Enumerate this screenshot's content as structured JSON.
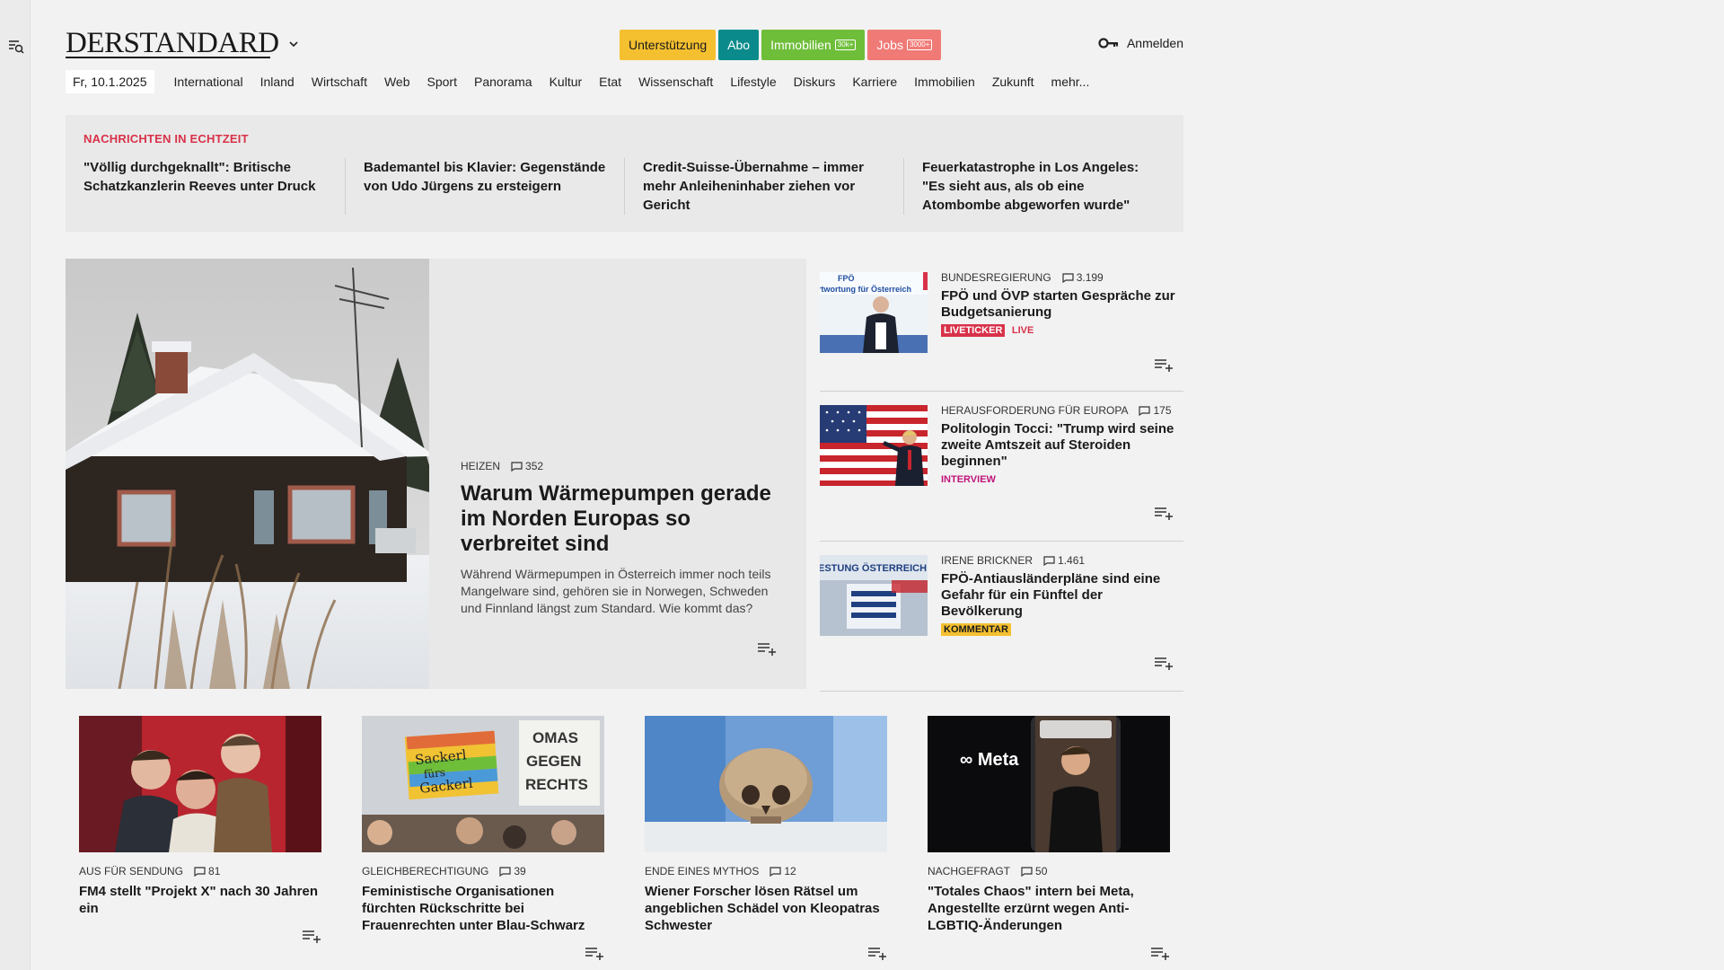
{
  "header": {
    "logo": "DERSTANDARD",
    "pills": [
      {
        "label": "Unterstützung",
        "badge": "",
        "bg": "#f5c030",
        "fg": "#1a1a1a"
      },
      {
        "label": "Abo",
        "badge": "",
        "bg": "#0a8a8a",
        "fg": "#ffffff"
      },
      {
        "label": "Immobilien",
        "badge": "30k+",
        "bg": "#6fbe3a",
        "fg": "#ffffff"
      },
      {
        "label": "Jobs",
        "badge": "3000+",
        "bg": "#f07a76",
        "fg": "#ffffff"
      }
    ],
    "login": "Anmelden"
  },
  "nav": {
    "date": "Fr, 10.1.2025",
    "items": [
      "International",
      "Inland",
      "Wirtschaft",
      "Web",
      "Sport",
      "Panorama",
      "Kultur",
      "Etat",
      "Wissenschaft",
      "Lifestyle",
      "Diskurs",
      "Karriere",
      "Immobilien",
      "Zukunft",
      "mehr..."
    ]
  },
  "ticker": {
    "label": "NACHRICHTEN IN ECHTZEIT",
    "items": [
      "\"Völlig durchgeknallt\": Britische Schatzkanzlerin Reeves unter Druck",
      "Bademantel bis Klavier: Gegenstände von Udo Jürgens zu ersteigern",
      "Credit-Suisse-Übernahme – immer mehr Anleiheninhaber ziehen vor Gericht",
      "Feuerkatastrophe in Los Angeles: \"Es sieht aus, als ob eine Atombombe abgeworfen wurde\""
    ]
  },
  "hero": {
    "kicker": "HEIZEN",
    "comments": "352",
    "title": "Warum Wärmepumpen gerade im Norden Europas so verbreitet sind",
    "lead": "Während Wärmepumpen in Österreich immer noch teils Mangelware sind, gehören sie in Norwegen, Schweden und Finnland längst zum Standard. Wie kommt das?"
  },
  "side": [
    {
      "kicker": "BUNDESREGIERUNG",
      "comments": "3.199",
      "title": "FPÖ und ÖVP starten Gespräche zur Budgetsanierung",
      "tag": "LIVETICKER",
      "tag2": "LIVE"
    },
    {
      "kicker": "HERAUSFORDERUNG FÜR EUROPA",
      "comments": "175",
      "title": "Politologin Tocci: \"Trump wird seine zweite Amtszeit auf Steroiden beginnen\"",
      "tag": "INTERVIEW",
      "tag2": ""
    },
    {
      "kicker": "IRENE BRICKNER",
      "comments": "1.461",
      "title": "FPÖ-Antiausländerpläne sind eine Gefahr für ein Fünftel der Bevölkerung",
      "tag": "KOMMENTAR",
      "tag2": ""
    }
  ],
  "images": {
    "fpo_banner": "FPÖ",
    "fpo_slogan": "rtwortung für Österreich",
    "poster_title": "ESTUNG ÖSTERREICH",
    "omas_sign": [
      "OMAS",
      "GEGEN",
      "RECHTS"
    ],
    "sackerl_sign": [
      "Sackerl",
      "fürs",
      "Gackerl"
    ],
    "meta_logo": "∞ Meta"
  },
  "cards": [
    {
      "kicker": "AUS FÜR SENDUNG",
      "comments": "81",
      "title": "FM4 stellt \"Projekt X\" nach 30 Jahren ein"
    },
    {
      "kicker": "GLEICHBERECHTIGUNG",
      "comments": "39",
      "title": "Feministische Organisationen fürchten Rückschritte bei Frauenrechten unter Blau-Schwarz"
    },
    {
      "kicker": "ENDE EINES MYTHOS",
      "comments": "12",
      "title": "Wiener Forscher lösen Rätsel um angeblichen Schädel von Kleopatras Schwester"
    },
    {
      "kicker": "NACHGEFRAGT",
      "comments": "50",
      "title": "\"Totales Chaos\" intern bei Meta, Angestellte erzürnt wegen Anti-LGBTIQ-Änderungen"
    }
  ],
  "colors": {
    "accent_red": "#d8324a",
    "interview_magenta": "#c0157a",
    "comment_yellow": "#f5c030"
  }
}
